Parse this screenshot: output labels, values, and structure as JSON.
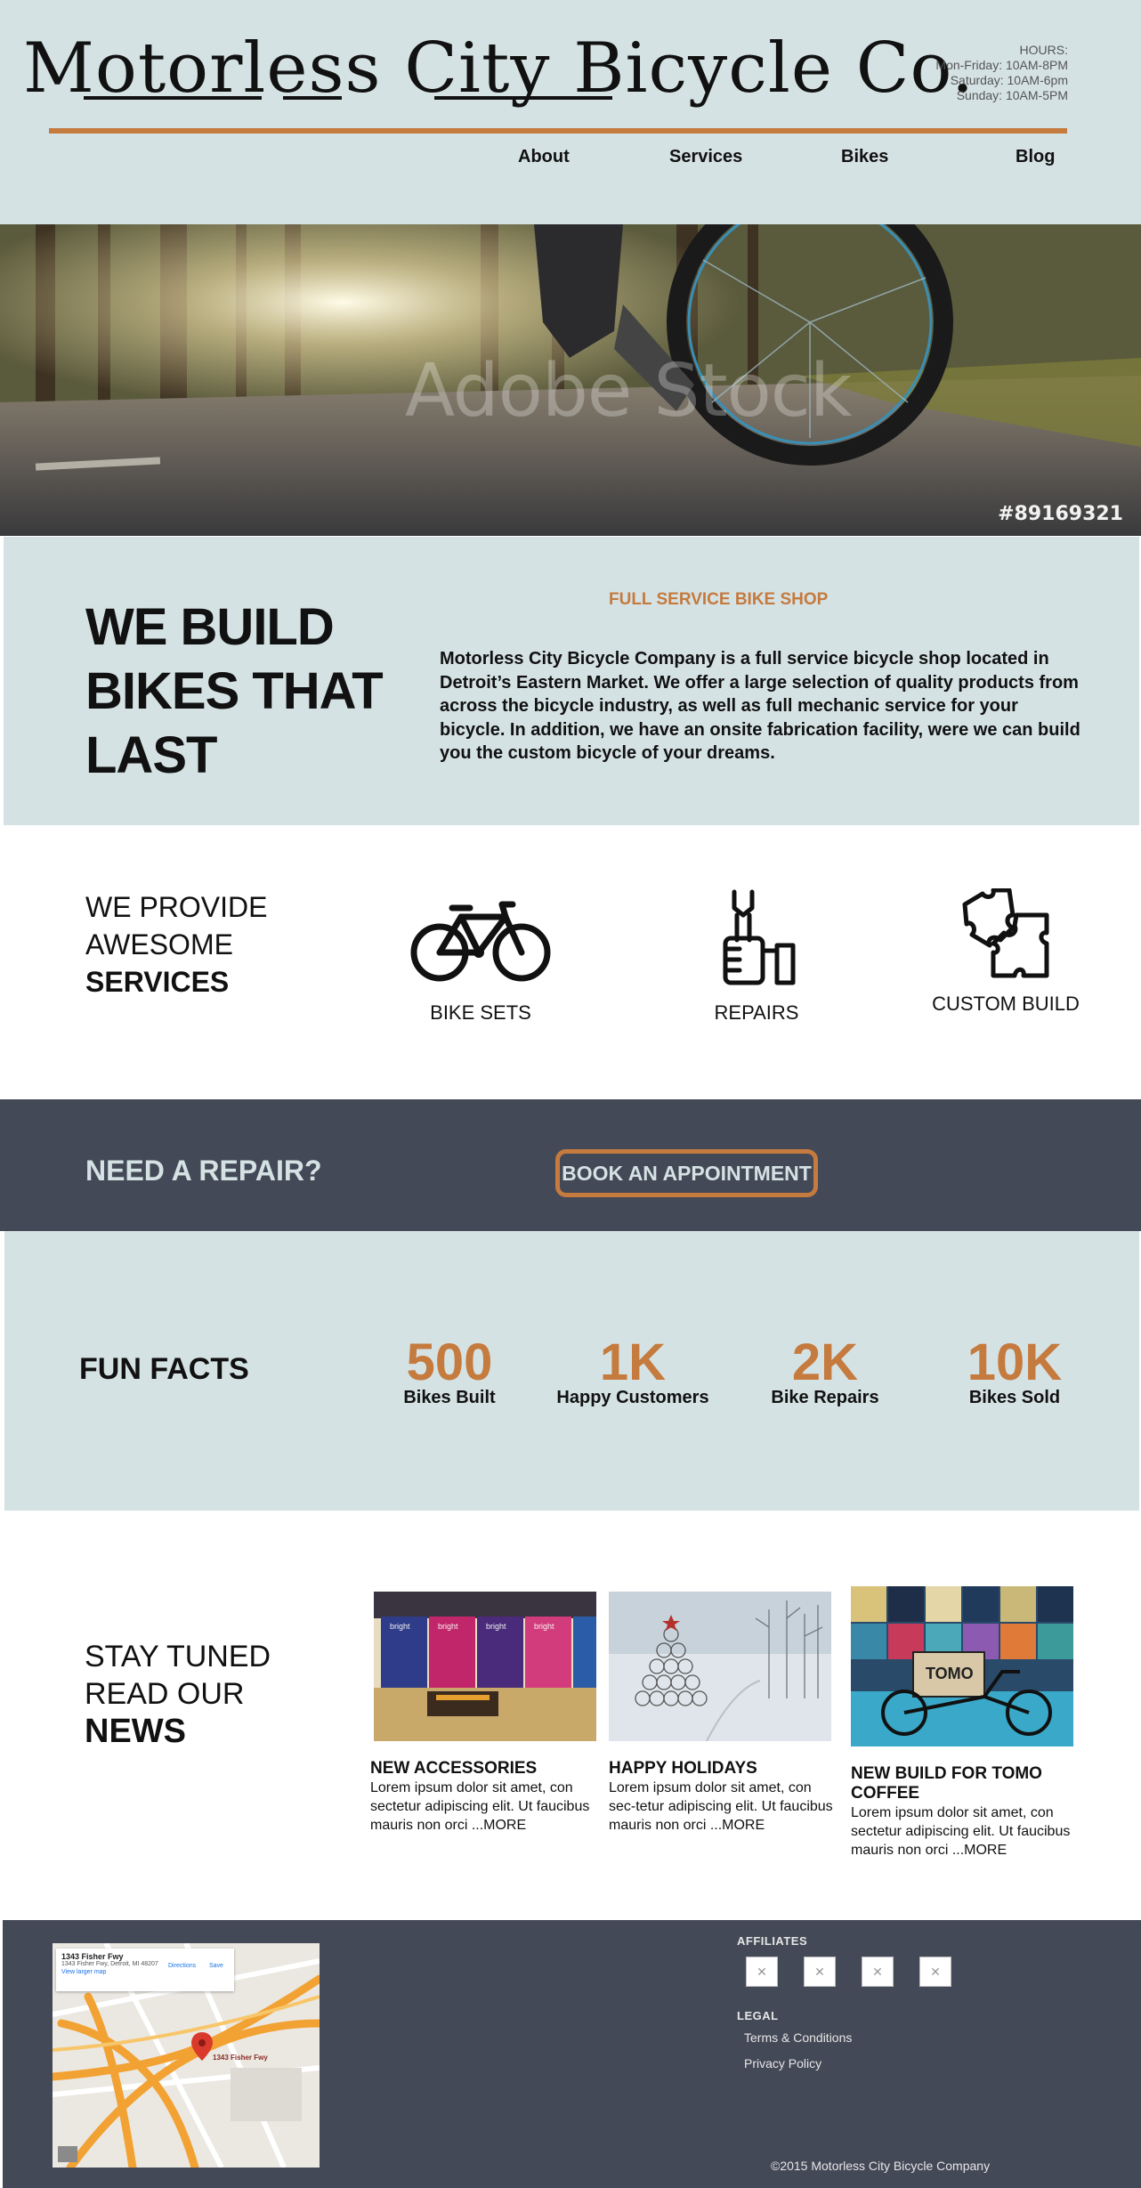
{
  "header": {
    "logo_text": "Motorless City Bicycle Co.",
    "hours": {
      "title": "HOURS:",
      "weekdays": "Mon-Friday: 10AM-8PM",
      "saturday": "Saturday: 10AM-6pm",
      "sunday": "Sunday: 10AM-5PM"
    },
    "nav": [
      "About",
      "Services",
      "Bikes",
      "Blog"
    ]
  },
  "hero": {
    "stock_id": "#89169321",
    "watermark": "Adobe Stock"
  },
  "about": {
    "heading": "WE BUILD BIKES THAT LAST",
    "subheading": "FULL SERVICE BIKE SHOP",
    "body": "Motorless City Bicycle Company is a full service bicycle shop located in Detroit’s Eastern Market.  We offer a large selection of quality products from across the bicycle industry, as well as full mechanic service for your bicycle.  In addition, we have an onsite fabrication facility, were we can build you the custom bicycle of your dreams."
  },
  "services": {
    "heading_line1": "WE PROVIDE",
    "heading_line2": "AWESOME",
    "heading_line3": "SERVICES",
    "items": [
      {
        "label": "BIKE SETS",
        "icon": "bicycle-icon"
      },
      {
        "label": "REPAIRS",
        "icon": "repair-hand-wrench-icon"
      },
      {
        "label": "CUSTOM BUILD",
        "icon": "puzzle-icon"
      }
    ]
  },
  "repair": {
    "text": "NEED A REPAIR?",
    "button": "BOOK AN APPOINTMENT"
  },
  "facts": {
    "title": "FUN FACTS",
    "items": [
      {
        "number": "500",
        "label": "Bikes Built"
      },
      {
        "number": "1K",
        "label": "Happy Customers"
      },
      {
        "number": "2K",
        "label": "Bike Repairs"
      },
      {
        "number": "10K",
        "label": "Bikes Sold"
      }
    ]
  },
  "news": {
    "heading_line1": "STAY TUNED",
    "heading_line2": "READ OUR",
    "heading_line3": "NEWS",
    "posts": [
      {
        "title": "NEW ACCESSORIES",
        "body": "Lorem ipsum dolor sit amet, con sectetur adipiscing elit. Ut faucibus mauris non orci ...MORE"
      },
      {
        "title": "HAPPY HOLIDAYS",
        "body": "Lorem ipsum dolor sit amet, con sec-tetur adipiscing elit. Ut faucibus mauris non orci ...MORE"
      },
      {
        "title": "NEW BUILD FOR TOMO COFFEE",
        "body": "Lorem ipsum dolor sit amet, con sectetur adipiscing elit. Ut faucibus mauris non orci ...MORE"
      }
    ]
  },
  "footer": {
    "map": {
      "place": "1343 Fisher Fwy",
      "address": "1343 Fisher Fwy, Detroit, MI 48207",
      "directions": "Directions",
      "save": "Save",
      "larger": "View larger map",
      "pin_label": "1343 Fisher Fwy"
    },
    "affiliates_title": "AFFILIATES",
    "affiliates_count": 4,
    "legal_title": "LEGAL",
    "legal_links": [
      "Terms & Conditions",
      "Privacy Policy"
    ],
    "copyright": "©2015 Motorless City Bicycle Company"
  },
  "colors": {
    "accent": "#c57a3e",
    "light_bg": "#d5e2e4",
    "dark_bg": "#444957"
  }
}
